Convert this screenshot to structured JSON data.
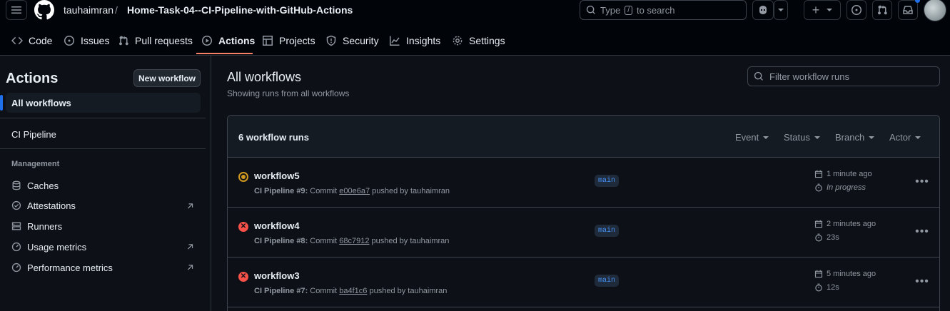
{
  "header": {
    "owner": "tauhaimran",
    "separator": "/",
    "repo": "Home-Task-04--CI-Pipeline-with-GitHub-Actions",
    "search_prefix": "Type",
    "search_key": "/",
    "search_suffix": "to search",
    "plus": "+"
  },
  "repo_nav": [
    {
      "label": "Code",
      "icon": "code-icon"
    },
    {
      "label": "Issues",
      "icon": "issue-icon"
    },
    {
      "label": "Pull requests",
      "icon": "pull-request-icon"
    },
    {
      "label": "Actions",
      "icon": "play-icon",
      "active": true
    },
    {
      "label": "Projects",
      "icon": "table-icon"
    },
    {
      "label": "Security",
      "icon": "shield-icon"
    },
    {
      "label": "Insights",
      "icon": "graph-icon"
    },
    {
      "label": "Settings",
      "icon": "gear-icon"
    }
  ],
  "sidebar": {
    "title": "Actions",
    "new_workflow": "New workflow",
    "all_workflows": "All workflows",
    "workflows": [
      "CI Pipeline"
    ],
    "management_heading": "Management",
    "management": [
      {
        "label": "Caches",
        "icon": "database-icon",
        "external": false
      },
      {
        "label": "Attestations",
        "icon": "verified-icon",
        "external": true
      },
      {
        "label": "Runners",
        "icon": "server-icon",
        "external": false
      },
      {
        "label": "Usage metrics",
        "icon": "meter-icon",
        "external": true
      },
      {
        "label": "Performance metrics",
        "icon": "meter-icon",
        "external": true
      }
    ]
  },
  "main": {
    "title": "All workflows",
    "subtitle": "Showing runs from all workflows",
    "filter_placeholder": "Filter workflow runs",
    "count": "6 workflow runs",
    "filters": [
      "Event",
      "Status",
      "Branch",
      "Actor"
    ]
  },
  "runs": [
    {
      "name": "workflow5",
      "status": "in-progress",
      "workflow": "CI Pipeline",
      "number": "#9",
      "commit_label": "Commit",
      "sha": "e00e6a7",
      "pushed_by": "pushed by tauhaimran",
      "branch": "main",
      "time": "1 minute ago",
      "duration": "In progress"
    },
    {
      "name": "workflow4",
      "status": "failure",
      "workflow": "CI Pipeline",
      "number": "#8",
      "commit_label": "Commit",
      "sha": "68c7912",
      "pushed_by": "pushed by tauhaimran",
      "branch": "main",
      "time": "2 minutes ago",
      "duration": "23s"
    },
    {
      "name": "workflow3",
      "status": "failure",
      "workflow": "CI Pipeline",
      "number": "#7",
      "commit_label": "Commit",
      "sha": "ba4f1c6",
      "pushed_by": "pushed by tauhaimran",
      "branch": "main",
      "time": "5 minutes ago",
      "duration": "12s"
    }
  ],
  "colors": {
    "accent": "#f78166",
    "link": "#4493f8",
    "in_progress": "#d29922",
    "failure": "#f85149"
  }
}
